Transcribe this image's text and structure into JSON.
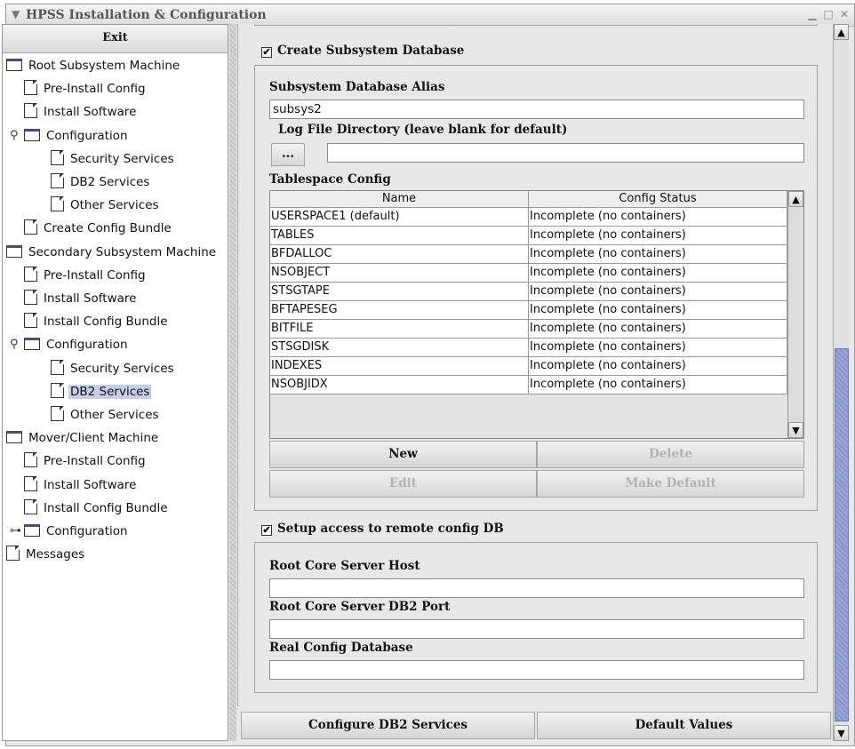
{
  "window": {
    "title": "HPSS Installation & Configuration",
    "minimize_glyph": "▁",
    "maximize_glyph": "□",
    "close_glyph": "✕"
  },
  "sidebar": {
    "exit_label": "Exit",
    "selected_item": "DB2 Services",
    "tree": [
      {
        "label": "Root Subsystem Machine",
        "kind": "folder",
        "level": 0
      },
      {
        "label": "Pre-Install Config",
        "kind": "doc",
        "level": 1
      },
      {
        "label": "Install Software",
        "kind": "doc",
        "level": 1
      },
      {
        "label": "Configuration",
        "kind": "folder",
        "level": 1,
        "expanded": true
      },
      {
        "label": "Security Services",
        "kind": "doc",
        "level": 2
      },
      {
        "label": "DB2 Services",
        "kind": "doc",
        "level": 2
      },
      {
        "label": "Other Services",
        "kind": "doc",
        "level": 2
      },
      {
        "label": "Create Config Bundle",
        "kind": "doc",
        "level": 1
      },
      {
        "label": "Secondary Subsystem Machine",
        "kind": "folder",
        "level": 0
      },
      {
        "label": "Pre-Install Config",
        "kind": "doc",
        "level": 1
      },
      {
        "label": "Install Software",
        "kind": "doc",
        "level": 1
      },
      {
        "label": "Install Config Bundle",
        "kind": "doc",
        "level": 1
      },
      {
        "label": "Configuration",
        "kind": "folder",
        "level": 1,
        "expanded": true
      },
      {
        "label": "Security Services",
        "kind": "doc",
        "level": 2
      },
      {
        "label": "DB2 Services",
        "kind": "doc",
        "level": 2,
        "selected": true
      },
      {
        "label": "Other Services",
        "kind": "doc",
        "level": 2
      },
      {
        "label": "Mover/Client Machine",
        "kind": "folder",
        "level": 0
      },
      {
        "label": "Pre-Install Config",
        "kind": "doc",
        "level": 1
      },
      {
        "label": "Install Software",
        "kind": "doc",
        "level": 1
      },
      {
        "label": "Install Config Bundle",
        "kind": "doc",
        "level": 1
      },
      {
        "label": "Configuration",
        "kind": "folder",
        "level": 1,
        "expanded": false
      },
      {
        "label": "Messages",
        "kind": "doc",
        "level": 0
      }
    ]
  },
  "main": {
    "create_db_checkbox": {
      "label": "Create Subsystem Database",
      "checked": true,
      "glyph": "✔"
    },
    "alias_label": "Subsystem Database Alias",
    "alias_value": "subsys2",
    "log_dir_label": "Log File Directory (leave blank for default)",
    "log_dir_browse": "...",
    "log_dir_value": "",
    "tablespace_label": "Tablespace Config",
    "table": {
      "columns": [
        "Name",
        "Config Status"
      ],
      "rows": [
        [
          "USERSPACE1 (default)",
          "Incomplete (no containers)"
        ],
        [
          "TABLES",
          "Incomplete (no containers)"
        ],
        [
          "BFDALLOC",
          "Incomplete (no containers)"
        ],
        [
          "NSOBJECT",
          "Incomplete (no containers)"
        ],
        [
          "STSGTAPE",
          "Incomplete (no containers)"
        ],
        [
          "BFTAPESEG",
          "Incomplete (no containers)"
        ],
        [
          "BITFILE",
          "Incomplete (no containers)"
        ],
        [
          "STSGDISK",
          "Incomplete (no containers)"
        ],
        [
          "INDEXES",
          "Incomplete (no containers)"
        ],
        [
          "NSOBJIDX",
          "Incomplete (no containers)"
        ]
      ]
    },
    "buttons": {
      "new": "New",
      "delete": "Delete",
      "edit": "Edit",
      "make_default": "Make Default"
    },
    "remote_checkbox": {
      "label": "Setup access to remote config DB",
      "checked": true,
      "glyph": "✔"
    },
    "root_host_label": "Root Core Server Host",
    "root_host_value": "",
    "root_port_label": "Root Core Server DB2 Port",
    "root_port_value": "",
    "real_db_label": "Real Config Database",
    "real_db_value": ""
  },
  "footer": {
    "configure": "Configure DB2 Services",
    "defaults": "Default Values"
  },
  "colors": {
    "selection": "#c8cdea",
    "scroll_thumb": "#9ea8d8"
  }
}
